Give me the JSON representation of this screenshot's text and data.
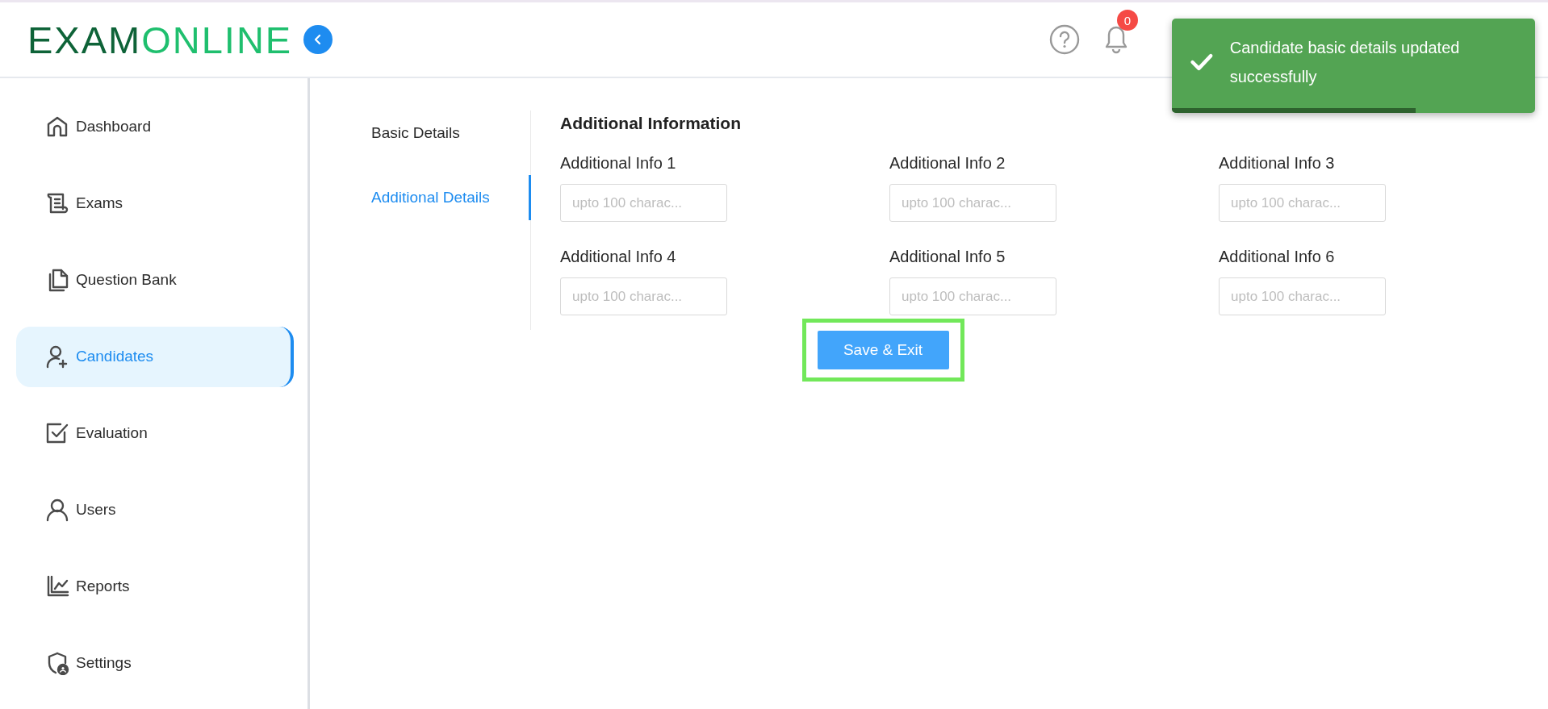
{
  "logo": {
    "part_1": "EXAM",
    "part_2": "ONLINE"
  },
  "header": {
    "notification_count": "0"
  },
  "toast": {
    "message": "Candidate basic details updated successfully",
    "level": 0.67
  },
  "sidebar": {
    "items": [
      {
        "label": "Dashboard",
        "selected": false
      },
      {
        "label": "Exams",
        "selected": false
      },
      {
        "label": "Question Bank",
        "selected": false
      },
      {
        "label": "Candidates",
        "selected": true
      },
      {
        "label": "Evaluation",
        "selected": false
      },
      {
        "label": "Users",
        "selected": false
      },
      {
        "label": "Reports",
        "selected": false
      },
      {
        "label": "Settings",
        "selected": false
      }
    ]
  },
  "tabs": [
    {
      "label": "Basic Details",
      "selected": false
    },
    {
      "label": "Additional Details",
      "selected": true
    }
  ],
  "form": {
    "title": "Additional Information",
    "fields": [
      {
        "label": "Additional Info 1",
        "placeholder": "upto 100 charac..."
      },
      {
        "label": "Additional Info 2",
        "placeholder": "upto 100 charac..."
      },
      {
        "label": "Additional Info 3",
        "placeholder": "upto 100 charac..."
      },
      {
        "label": "Additional Info 4",
        "placeholder": "upto 100 charac..."
      },
      {
        "label": "Additional Info 5",
        "placeholder": "upto 100 charac..."
      },
      {
        "label": "Additional Info 6",
        "placeholder": "upto 100 charac..."
      }
    ],
    "button": {
      "label": "Save & Exit",
      "highlighted": true
    }
  }
}
